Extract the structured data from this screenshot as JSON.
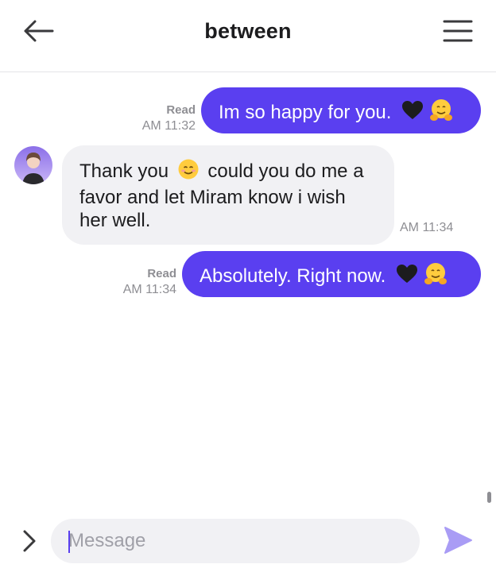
{
  "header": {
    "title": "between",
    "back_icon": "arrow-left-icon",
    "menu_icon": "hamburger-menu-icon"
  },
  "messages": [
    {
      "direction": "outgoing",
      "text": "Im so happy for you.",
      "emojis": [
        "black-heart",
        "hugging-face"
      ],
      "status": "Read",
      "time": "AM 11:32"
    },
    {
      "direction": "incoming",
      "lines": [
        "Thank you",
        "could you do me a",
        "favor and let Miram know i wish",
        "her well."
      ],
      "emoji_inline": "smiling-face",
      "time": "AM 11:34"
    },
    {
      "direction": "outgoing",
      "text": "Absolutely. Right now.",
      "emojis": [
        "black-heart",
        "hugging-face"
      ],
      "status": "Read",
      "time": "AM 11:34"
    }
  ],
  "composer": {
    "placeholder": "Message",
    "expand_icon": "chevron-right-icon",
    "send_icon": "send-icon"
  },
  "colors": {
    "accent": "#5a3ff0",
    "send": "#a99cf5",
    "incoming_bubble": "#f1f1f4",
    "meta_text": "#8e8e93"
  }
}
